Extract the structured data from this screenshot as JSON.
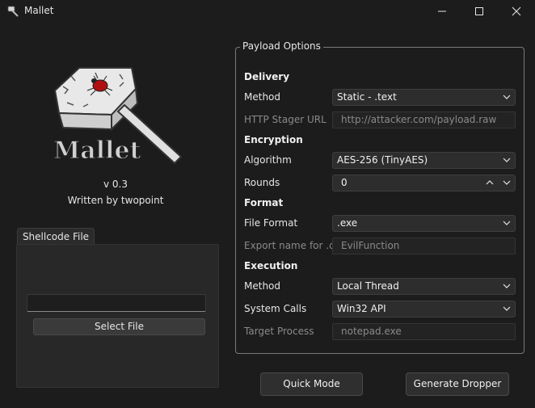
{
  "window": {
    "title": "Mallet",
    "icon": "hammer-icon",
    "controls": [
      "minimize-icon",
      "maximize-icon",
      "close-icon"
    ]
  },
  "about": {
    "logo_text": "Mallet",
    "version": "v 0.3",
    "author": "Written by twopoint"
  },
  "shellcode": {
    "tab_label": "Shellcode File",
    "path_value": "",
    "select_button": "Select File"
  },
  "payload": {
    "group_title": "Payload Options",
    "delivery": {
      "heading": "Delivery",
      "method_label": "Method",
      "method_value": "Static - .text",
      "stager_label": "HTTP Stager URL",
      "stager_placeholder": "http://attacker.com/payload.raw"
    },
    "encryption": {
      "heading": "Encryption",
      "algorithm_label": "Algorithm",
      "algorithm_value": "AES-256 (TinyAES)",
      "rounds_label": "Rounds",
      "rounds_value": "0"
    },
    "format": {
      "heading": "Format",
      "file_format_label": "File Format",
      "file_format_value": ".exe",
      "export_label": "Export name for .dll",
      "export_placeholder": "EvilFunction"
    },
    "execution": {
      "heading": "Execution",
      "method_label": "Method",
      "method_value": "Local Thread",
      "syscalls_label": "System Calls",
      "syscalls_value": "Win32 API",
      "target_label": "Target Process",
      "target_placeholder": "notepad.exe"
    }
  },
  "actions": {
    "quick_mode": "Quick Mode",
    "generate": "Generate Dropper"
  }
}
